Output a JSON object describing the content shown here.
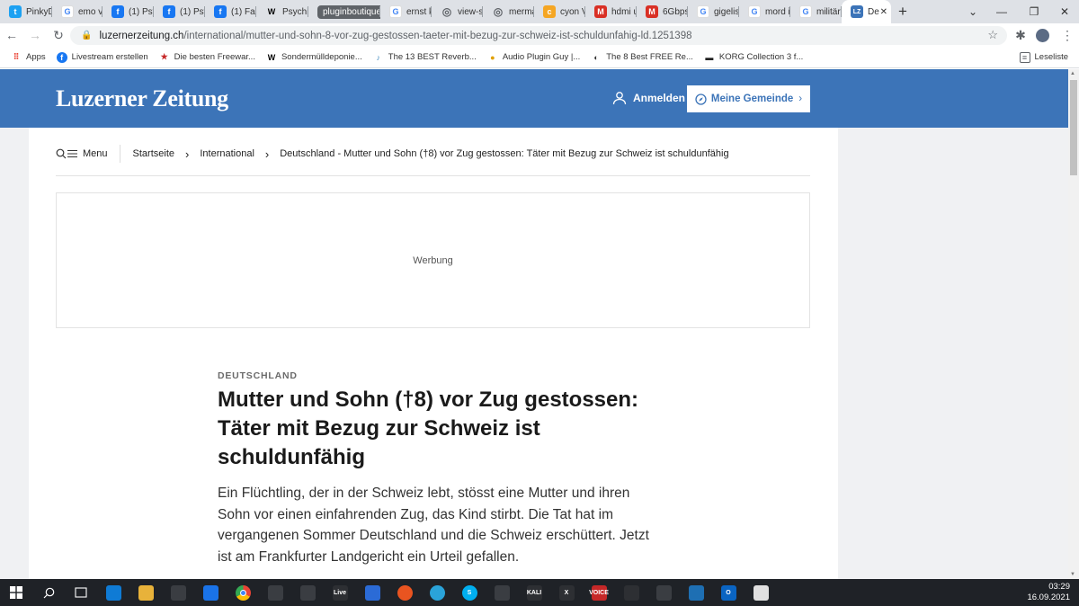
{
  "browser": {
    "tabs": [
      {
        "label": "PinkyD",
        "icon": "twitter-icon",
        "color": "#1da1f2"
      },
      {
        "label": "emo vi",
        "icon": "google-icon",
        "color": "#4285f4"
      },
      {
        "label": "(1) Psy",
        "icon": "facebook-icon",
        "color": "#1877f2"
      },
      {
        "label": "(1) Psy",
        "icon": "facebook-icon",
        "color": "#1877f2"
      },
      {
        "label": "(1) Fac",
        "icon": "facebook-icon",
        "color": "#1877f2"
      },
      {
        "label": "Psychi",
        "icon": "wikipedia-icon",
        "color": "#000000"
      },
      {
        "label": "pluginboutique",
        "group": true
      },
      {
        "label": "ernst k",
        "icon": "google-icon",
        "color": "#4285f4"
      },
      {
        "label": "view-s",
        "icon": "globe-icon",
        "color": "#5f6368"
      },
      {
        "label": "merma",
        "icon": "globe-icon",
        "color": "#5f6368"
      },
      {
        "label": "cyon V",
        "icon": "cyon-icon",
        "color": "#f5a623"
      },
      {
        "label": "hdmi u",
        "icon": "mail-icon",
        "color": "#d93025"
      },
      {
        "label": "6Gbps",
        "icon": "mail-icon",
        "color": "#d93025"
      },
      {
        "label": "gigelis",
        "icon": "google-icon",
        "color": "#4285f4"
      },
      {
        "label": "mord i",
        "icon": "google-icon",
        "color": "#4285f4"
      },
      {
        "label": "militär",
        "icon": "google-icon",
        "color": "#4285f4"
      },
      {
        "label": "De",
        "icon": "lz-icon",
        "color": "#3c74b8",
        "active": true
      }
    ],
    "new_tab": "+",
    "url_domain": "luzernerzeitung.ch",
    "url_path": "/international/mutter-und-sohn-8-vor-zug-gestossen-taeter-mit-bezug-zur-schweiz-ist-schuldunfahig-ld.1251398",
    "bookmarks": [
      {
        "label": "Apps",
        "icon": "apps-grid-icon",
        "color": "#ea4335"
      },
      {
        "label": "Livestream erstellen",
        "icon": "facebook-icon",
        "color": "#1877f2"
      },
      {
        "label": "Die besten Freewar...",
        "icon": "star-icon",
        "color": "#c62828"
      },
      {
        "label": "Sondermülldeponie...",
        "icon": "wikipedia-icon",
        "color": "#000000"
      },
      {
        "label": "The 13 BEST Reverb...",
        "icon": "musician-icon",
        "color": "#4a90c2"
      },
      {
        "label": "Audio Plugin Guy |...",
        "icon": "plugin-guy-icon",
        "color": "#e0a000"
      },
      {
        "label": "The 8 Best FREE Re...",
        "icon": "circle-icon",
        "color": "#333333"
      },
      {
        "label": "KORG Collection 3 f...",
        "icon": "korg-icon",
        "color": "#222222"
      }
    ],
    "reading_list": "Leseliste"
  },
  "site": {
    "logo": "Luzerner Zeitung",
    "login": "Anmelden",
    "gemeinde": "Meine Gemeinde",
    "brand_color": "#3c74b8",
    "menu": "Menu",
    "breadcrumb": [
      "Startseite",
      "International",
      "Deutschland - Mutter und Sohn (†8) vor Zug gestossen: Täter mit Bezug zur Schweiz ist schuldunfähig"
    ],
    "ad_label": "Werbung"
  },
  "article": {
    "kicker": "DEUTSCHLAND",
    "headline": "Mutter und Sohn (†8) vor Zug gestossen: Täter mit Bezug zur Schweiz ist schuldunfähig",
    "lead": "Ein Flüchtling, der in der Schweiz lebt, stösst eine Mutter und ihren Sohn vor einen einfahrenden Zug, das Kind stirbt. Die Tat hat im vergangenen Sommer Deutschland und die Schweiz erschüttert. Jetzt ist am Frankfurter Landgericht ein Urteil gefallen."
  },
  "taskbar": {
    "apps": [
      {
        "name": "search-icon",
        "color": "#1f2227",
        "text": ""
      },
      {
        "name": "task-view-icon",
        "color": "#1f2227",
        "text": ""
      },
      {
        "name": "edge-icon",
        "color": "#0f7bd5",
        "text": ""
      },
      {
        "name": "file-explorer-icon",
        "color": "#e8b23a",
        "text": ""
      },
      {
        "name": "store-icon",
        "color": "#3a3d42",
        "text": ""
      },
      {
        "name": "mail-icon",
        "color": "#1a73e8",
        "text": ""
      },
      {
        "name": "chrome-icon",
        "color": "#34a853",
        "text": ""
      },
      {
        "name": "app-icon",
        "color": "#3a3d42",
        "text": ""
      },
      {
        "name": "inkscape-icon",
        "color": "#3a3d42",
        "text": ""
      },
      {
        "name": "ableton-live-icon",
        "color": "#2d2f33",
        "text": "Live"
      },
      {
        "name": "webex-icon",
        "color": "#2b6bd6",
        "text": ""
      },
      {
        "name": "ubuntu-icon",
        "color": "#e95420",
        "text": ""
      },
      {
        "name": "telegram-icon",
        "color": "#2aa3d9",
        "text": ""
      },
      {
        "name": "skype-icon",
        "color": "#00aff0",
        "text": "S"
      },
      {
        "name": "terminal-icon",
        "color": "#3a3d42",
        "text": ""
      },
      {
        "name": "kali-icon",
        "color": "#2d2f33",
        "text": "KALI"
      },
      {
        "name": "x-app-icon",
        "color": "#2d2f33",
        "text": "X"
      },
      {
        "name": "voicemeeter-icon",
        "color": "#c62828",
        "text": "VOICE"
      },
      {
        "name": "cloud-app-icon",
        "color": "#2d2f33",
        "text": ""
      },
      {
        "name": "media-app-icon",
        "color": "#3a3d42",
        "text": ""
      },
      {
        "name": "virtualbox-icon",
        "color": "#1e6fb3",
        "text": ""
      },
      {
        "name": "outlook-icon",
        "color": "#0a64c2",
        "text": "O"
      },
      {
        "name": "notepad-icon",
        "color": "#e0e0e0",
        "text": ""
      }
    ],
    "time": "03:29",
    "date": "16.09.2021"
  }
}
